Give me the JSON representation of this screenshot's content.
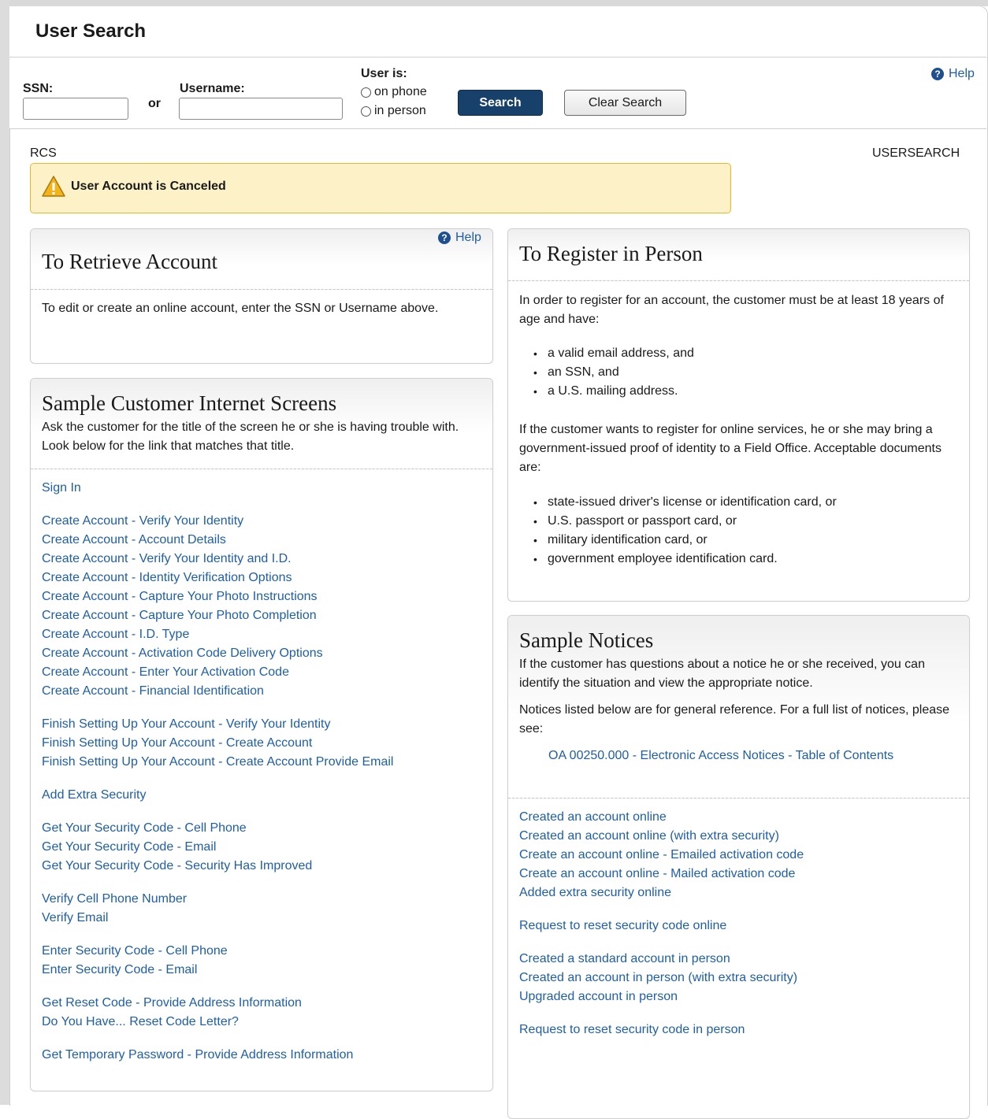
{
  "header": {
    "title": "User Search"
  },
  "search": {
    "ssn_label": "SSN:",
    "or_label": "or",
    "username_label": "Username:",
    "user_is_label": "User is:",
    "on_phone_label": "on phone",
    "in_person_label": "in person",
    "search_button": "Search",
    "clear_button": "Clear Search",
    "help_label": "Help"
  },
  "context": {
    "left_label": "RCS",
    "right_label": "USERSEARCH"
  },
  "alert": {
    "message": "User Account is Canceled",
    "icon": "warning-icon"
  },
  "retrieve": {
    "title": "To Retrieve Account",
    "help_label": "Help",
    "body": "To edit or create an online account, enter the SSN or Username above."
  },
  "sample_screens": {
    "title": "Sample Customer Internet Screens",
    "intro": "Ask the customer for the title of the screen he or she is having trouble with. Look below for the link that matches that title.",
    "groups": [
      [
        "Sign In"
      ],
      [
        "Create Account - Verify Your Identity",
        "Create Account - Account Details",
        "Create Account - Verify Your Identity and I.D.",
        "Create Account - Identity Verification Options",
        "Create Account - Capture Your Photo Instructions",
        "Create Account - Capture Your Photo Completion",
        "Create Account - I.D. Type",
        "Create Account - Activation Code Delivery Options",
        "Create Account - Enter Your Activation Code",
        "Create Account - Financial Identification"
      ],
      [
        "Finish Setting Up Your Account - Verify Your Identity",
        "Finish Setting Up Your Account - Create Account",
        "Finish Setting Up Your Account - Create Account Provide Email"
      ],
      [
        "Add Extra Security"
      ],
      [
        "Get Your Security Code - Cell Phone",
        "Get Your Security Code - Email",
        "Get Your Security Code - Security Has Improved"
      ],
      [
        "Verify Cell Phone Number",
        "Verify Email"
      ],
      [
        "Enter Security Code - Cell Phone",
        "Enter Security Code - Email"
      ],
      [
        "Get Reset Code - Provide Address Information",
        "Do You Have... Reset Code Letter?"
      ],
      [
        "Get Temporary Password - Provide Address Information"
      ]
    ]
  },
  "register": {
    "title": "To Register in Person",
    "intro": "In order to register for an account, the customer must be at least 18 years of age and have:",
    "requirements": [
      "a valid email address, and",
      "an SSN, and",
      "a U.S. mailing address."
    ],
    "middle": "If the customer wants to register for online services, he or she may bring a government-issued proof of identity to a Field Office. Acceptable documents are:",
    "documents": [
      "state-issued driver's license or identification card, or",
      "U.S. passport or passport card, or",
      "military identification card, or",
      "government employee identification card."
    ]
  },
  "notices": {
    "title": "Sample Notices",
    "intro": "If the customer has questions about a notice he or she received, you can identify the situation and view the appropriate notice.",
    "reference": "Notices listed below are for general reference. For a full list of notices, please see:",
    "toc_link": "OA 00250.000 - Electronic Access Notices - Table of Contents",
    "groups": [
      [
        "Created an account online",
        "Created an account online (with extra security)",
        "Create an account online - Emailed activation code",
        "Create an account online - Mailed activation code",
        "Added extra security online"
      ],
      [
        "Request to reset security code online"
      ],
      [
        "Created a standard account in person",
        "Created an account in person (with extra security)",
        "Upgraded account in person"
      ],
      [
        "Request to reset security code in person"
      ]
    ]
  },
  "colors": {
    "primary_button": "#17406a",
    "link": "#1f5ea8",
    "alert_bg": "#fdf1c8",
    "alert_border": "#e7b62d"
  }
}
